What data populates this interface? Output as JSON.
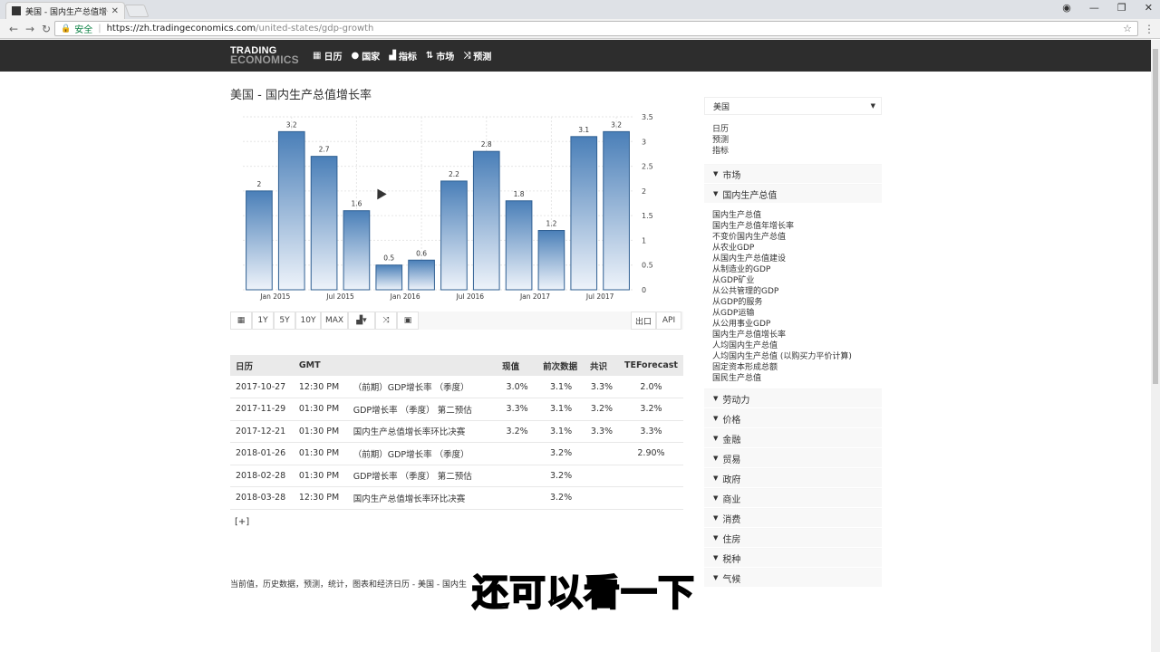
{
  "browser": {
    "tab_title": "美国 - 国内生产总值增长率",
    "secure_label": "安全",
    "url_host": "https://zh.tradingeconomics.com",
    "url_path": "/united-states/gdp-growth"
  },
  "site": {
    "logo_line1": "TRADING",
    "logo_line2": "ECONOMICS",
    "nav": [
      {
        "label": "日历",
        "icon": "calendar-icon"
      },
      {
        "label": "国家",
        "icon": "globe-icon"
      },
      {
        "label": "指标",
        "icon": "bar-chart-icon"
      },
      {
        "label": "市场",
        "icon": "arrows-updown-icon"
      },
      {
        "label": "预测",
        "icon": "shuffle-icon"
      }
    ]
  },
  "page": {
    "title": "美国 - 国内生产总值增长率",
    "footer_text": "当前值，历史数据，预测，统计，图表和经济日历 - 美国 - 国内生"
  },
  "chart_data": {
    "type": "bar",
    "categories": [
      "2015Q1",
      "2015Q2",
      "2015Q3",
      "2015Q4",
      "2016Q1",
      "2016Q2",
      "2016Q3",
      "2016Q4",
      "2017Q1",
      "2017Q2",
      "2017Q3",
      "2017Q4"
    ],
    "values": [
      2,
      3.2,
      2.7,
      1.6,
      0.5,
      0.6,
      2.2,
      2.8,
      1.8,
      1.2,
      3.1,
      3.2
    ],
    "value_labels": [
      "2",
      "3.2",
      "2.7",
      "1.6",
      "0.5",
      "0.6",
      "2.2",
      "2.8",
      "1.8",
      "1.2",
      "3.1",
      "3.2"
    ],
    "x_tick_labels": [
      {
        "label": "Jan 2015",
        "index": 0.5
      },
      {
        "label": "Jul 2015",
        "index": 2.5
      },
      {
        "label": "Jan 2016",
        "index": 4.5
      },
      {
        "label": "Jul 2016",
        "index": 6.5
      },
      {
        "label": "Jan 2017",
        "index": 8.5
      },
      {
        "label": "Jul 2017",
        "index": 10.5
      }
    ],
    "y_ticks": [
      "0",
      "0.5",
      "1",
      "1.5",
      "2",
      "2.5",
      "3",
      "3.5"
    ],
    "ylim": [
      0,
      3.5
    ],
    "grid": true,
    "y_axis_side": "right",
    "bar_color_top": "#4a7fb8",
    "bar_color_bottom": "#eef3fa"
  },
  "chart_toolbar": {
    "range_buttons": [
      "1Y",
      "5Y",
      "10Y",
      "MAX"
    ],
    "export_label": "出口",
    "api_label": "API"
  },
  "calendar": {
    "headers": [
      "日历",
      "GMT",
      "",
      "现值",
      "前次数据",
      "共识",
      "TEForecast"
    ],
    "rows": [
      [
        "2017-10-27",
        "12:30 PM",
        "（前期）GDP增长率 （季度）",
        "3.0%",
        "3.1%",
        "3.3%",
        "2.0%"
      ],
      [
        "2017-11-29",
        "01:30 PM",
        "GDP增长率 （季度） 第二预估",
        "3.3%",
        "3.1%",
        "3.2%",
        "3.2%"
      ],
      [
        "2017-12-21",
        "01:30 PM",
        "国内生产总值增长率环比决赛",
        "3.2%",
        "3.1%",
        "3.3%",
        "3.3%"
      ],
      [
        "2018-01-26",
        "01:30 PM",
        "（前期）GDP增长率 （季度）",
        "",
        "3.2%",
        "",
        "2.90%"
      ],
      [
        "2018-02-28",
        "01:30 PM",
        "GDP增长率 （季度） 第二预估",
        "",
        "3.2%",
        "",
        ""
      ],
      [
        "2018-03-28",
        "12:30 PM",
        "国内生产总值增长率环比决赛",
        "",
        "3.2%",
        "",
        ""
      ]
    ],
    "expand_label": "[+]"
  },
  "sidebar": {
    "country": "美国",
    "quick_links": [
      "日历",
      "预测",
      "指标"
    ],
    "markets_label": "市场",
    "gdp_label": "国内生产总值",
    "gdp_links": [
      "国内生产总值",
      "国内生产总值年增长率",
      "不变价国内生产总值",
      "从农业GDP",
      "从国内生产总值建设",
      "从制造业的GDP",
      "从GDP矿业",
      "从公共管理的GDP",
      "从GDP的服务",
      "从GDP运输",
      "从公用事业GDP",
      "国内生产总值增长率",
      "人均国内生产总值",
      "人均国内生产总值 (以购买力平价计算)",
      "固定资本形成总额",
      "国民生产总值"
    ],
    "categories": [
      "劳动力",
      "价格",
      "金融",
      "贸易",
      "政府",
      "商业",
      "消费",
      "住房",
      "税种",
      "气候"
    ]
  },
  "overlay": {
    "subtitle": "还可以看一下"
  }
}
